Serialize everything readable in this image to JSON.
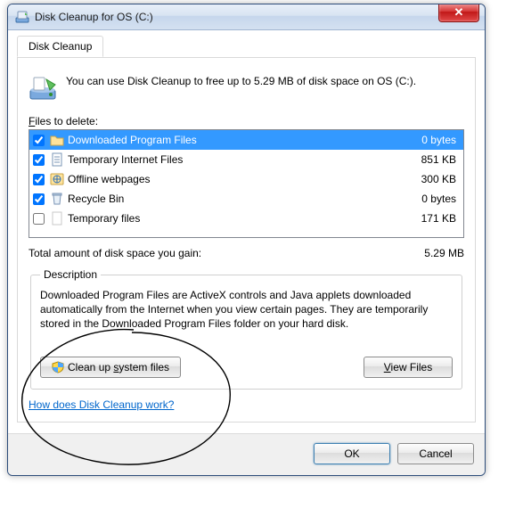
{
  "window": {
    "title": "Disk Cleanup for OS (C:)"
  },
  "tab": {
    "label": "Disk Cleanup"
  },
  "intro": "You can use Disk Cleanup to free up to 5.29 MB of disk space on OS (C:).",
  "files_label_pre": "F",
  "files_label_rest": "iles to delete:",
  "files": [
    {
      "checked": true,
      "name": "Downloaded Program Files",
      "size": "0 bytes",
      "selected": true,
      "icon": "folder"
    },
    {
      "checked": true,
      "name": "Temporary Internet Files",
      "size": "851 KB",
      "selected": false,
      "icon": "page"
    },
    {
      "checked": true,
      "name": "Offline webpages",
      "size": "300 KB",
      "selected": false,
      "icon": "web"
    },
    {
      "checked": true,
      "name": "Recycle Bin",
      "size": "0 bytes",
      "selected": false,
      "icon": "bin"
    },
    {
      "checked": false,
      "name": "Temporary files",
      "size": "171 KB",
      "selected": false,
      "icon": "blank"
    }
  ],
  "total": {
    "label": "Total amount of disk space you gain:",
    "value": "5.29 MB"
  },
  "description": {
    "legend": "Description",
    "text": "Downloaded Program Files are ActiveX controls and Java applets downloaded automatically from the Internet when you view certain pages. They are temporarily stored in the Downloaded Program Files folder on your hard disk."
  },
  "buttons": {
    "cleanup_pre": "Clean up ",
    "cleanup_ul": "s",
    "cleanup_post": "ystem files",
    "view_ul": "V",
    "view_post": "iew Files",
    "ok": "OK",
    "cancel": "Cancel"
  },
  "help_link": "How does Disk Cleanup work?"
}
